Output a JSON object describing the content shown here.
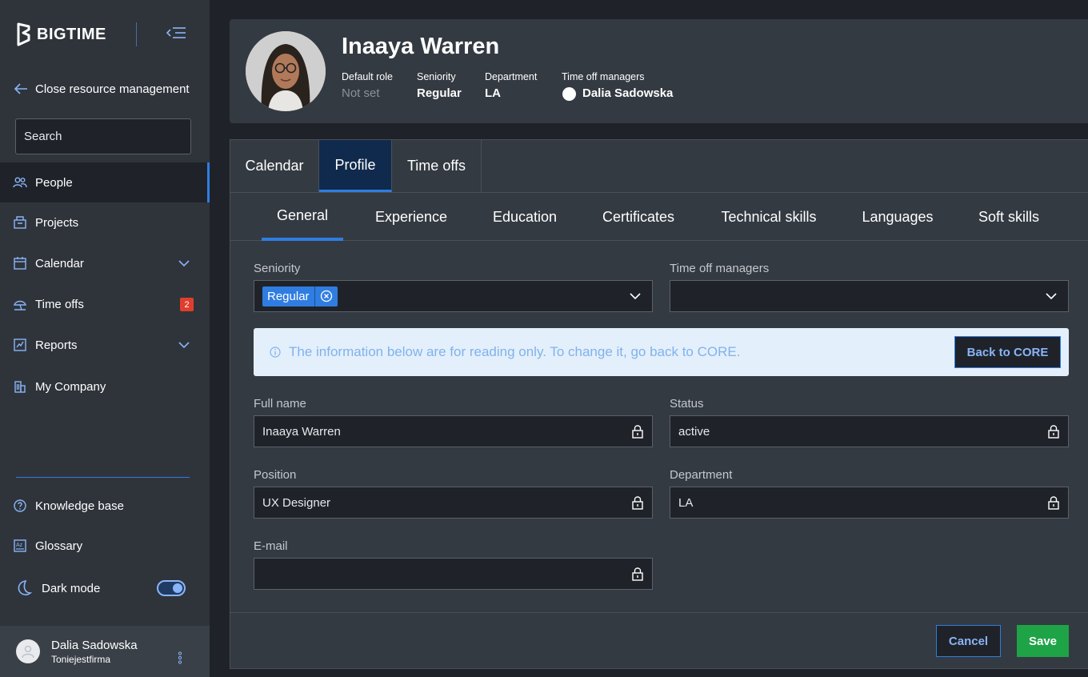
{
  "app": {
    "logo_text": "BIGTIME"
  },
  "sidebar": {
    "close_label": "Close resource management",
    "search_placeholder": "Search",
    "items": [
      {
        "label": "People",
        "icon": "people-icon",
        "active": true
      },
      {
        "label": "Projects",
        "icon": "projects-icon"
      },
      {
        "label": "Calendar",
        "icon": "calendar-icon",
        "expandable": true
      },
      {
        "label": "Time offs",
        "icon": "time-offs-icon",
        "badge": "2"
      },
      {
        "label": "Reports",
        "icon": "reports-icon",
        "expandable": true
      },
      {
        "label": "My Company",
        "icon": "company-icon"
      }
    ],
    "bottom_items": [
      {
        "label": "Knowledge base",
        "icon": "help-icon"
      },
      {
        "label": "Glossary",
        "icon": "glossary-icon"
      }
    ],
    "dark_mode_label": "Dark mode",
    "dark_mode_on": true,
    "user": {
      "name": "Dalia Sadowska",
      "company": "Toniejestfirma"
    }
  },
  "header": {
    "name": "Inaaya Warren",
    "default_role_label": "Default role",
    "default_role_value": "Not set",
    "seniority_label": "Seniority",
    "seniority_value": "Regular",
    "department_label": "Department",
    "department_value": "LA",
    "managers_label": "Time off managers",
    "managers_value": "Dalia Sadowska"
  },
  "tabs": [
    "Calendar",
    "Profile",
    "Time offs"
  ],
  "active_tab": "Profile",
  "subtabs": [
    "General",
    "Experience",
    "Education",
    "Certificates",
    "Technical skills",
    "Languages",
    "Soft skills"
  ],
  "active_subtab": "General",
  "form": {
    "seniority_label": "Seniority",
    "seniority_chip": "Regular",
    "managers_label": "Time off managers",
    "managers_value": "",
    "info_text": "The information below are for reading only. To change it, go back to CORE.",
    "back_to_core": "Back to CORE",
    "full_name_label": "Full name",
    "full_name_value": "Inaaya Warren",
    "status_label": "Status",
    "status_value": "active",
    "position_label": "Position",
    "position_value": "UX Designer",
    "department_label": "Department",
    "department_value": "LA",
    "email_label": "E-mail",
    "email_value": ""
  },
  "actions": {
    "cancel": "Cancel",
    "save": "Save"
  },
  "colors": {
    "accent": "#2f7de1",
    "save": "#1ea446",
    "badge": "#e03e2d",
    "sidebar_bg": "#2f343b"
  }
}
